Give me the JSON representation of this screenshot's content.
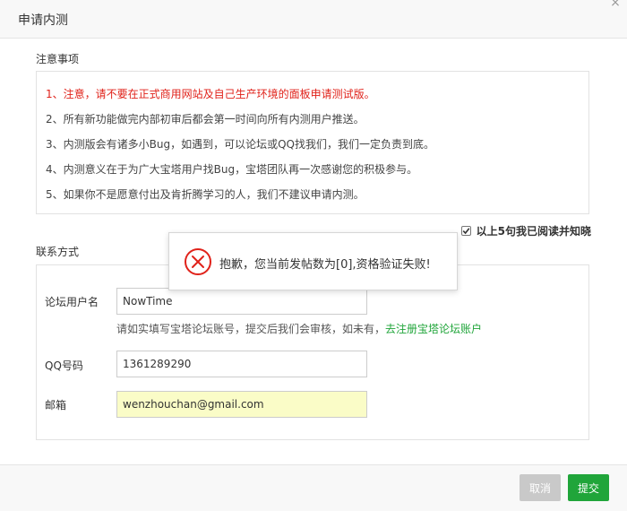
{
  "dialog": {
    "title": "申请内测",
    "close_glyph": "×"
  },
  "notice": {
    "heading": "注意事项",
    "lines": [
      "1、注意，请不要在正式商用网站及自己生产环境的面板申请测试版。",
      "2、所有新功能做完内部初审后都会第一时间向所有内测用户推送。",
      "3、内测版会有诸多小Bug，如遇到，可以论坛或QQ找我们，我们一定负责到底。",
      "4、内测意义在于为广大宝塔用户找Bug，宝塔团队再一次感谢您的积极参与。",
      "5、如果你不是愿意付出及肯折腾学习的人，我们不建议申请内测。"
    ],
    "first_line_color": "#e0221a"
  },
  "agreement": {
    "label": "以上5句我已阅读并知晓",
    "checked": true
  },
  "contact": {
    "heading": "联系方式",
    "forum_user_label": "论坛用户名",
    "forum_user_value": "NowTime",
    "hint_text": "请如实填写宝塔论坛账号，提交后我们会审核，如未有，",
    "hint_link": "去注册宝塔论坛账户",
    "qq_label": "QQ号码",
    "qq_value": "1361289290",
    "email_label": "邮箱",
    "email_value": "wenzhouchan@gmail.com"
  },
  "footer": {
    "cancel_label": "取消",
    "submit_label": "提交"
  },
  "toast": {
    "icon": "error-circle-icon",
    "message": "抱歉，您当前发帖数为[0],资格验证失败!"
  },
  "colors": {
    "accent": "#20a53a",
    "error": "#e0221a"
  }
}
